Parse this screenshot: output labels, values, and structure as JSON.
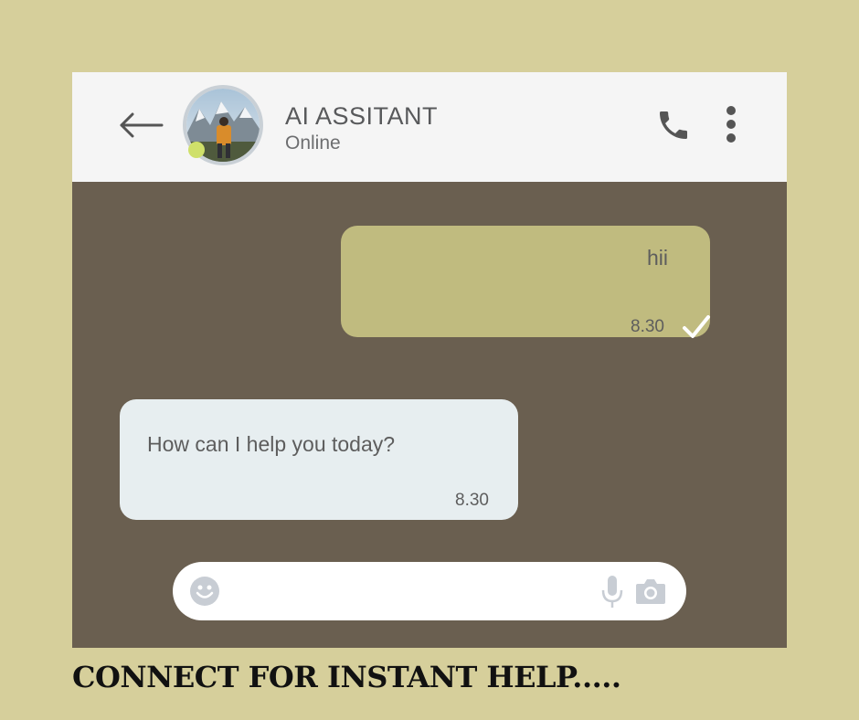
{
  "header": {
    "contact_name": "AI ASSITANT",
    "status": "Online",
    "icons": {
      "back": "back-arrow-icon",
      "phone": "phone-icon",
      "more": "more-vertical-icon"
    }
  },
  "messages": [
    {
      "direction": "outgoing",
      "text": "hii",
      "time": "8.30",
      "status": "delivered-check"
    },
    {
      "direction": "incoming",
      "text": "How can I help you today?",
      "time": "8.30"
    }
  ],
  "composer": {
    "placeholder": "",
    "icons": [
      "emoji-icon",
      "microphone-icon",
      "camera-icon"
    ]
  },
  "caption": "CONNECT FOR INSTANT HELP.....",
  "colors": {
    "page_background": "#d6cf9b",
    "chat_background": "#6a5f50",
    "header_background": "#f5f5f5",
    "outgoing_bubble": "#c0bb7f",
    "incoming_bubble": "#e7eef0",
    "online_indicator": "#cfe06a"
  }
}
